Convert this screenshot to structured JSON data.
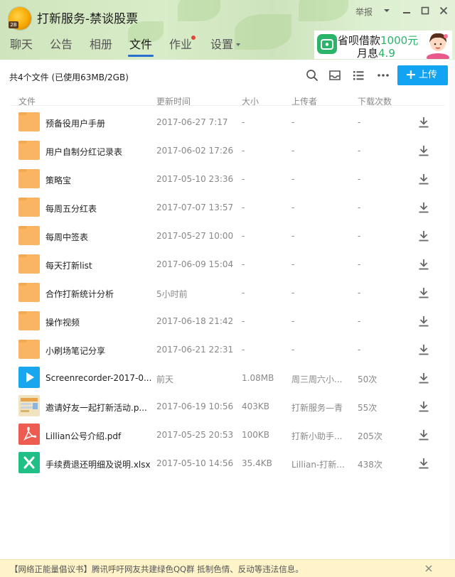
{
  "header": {
    "title": "打新服务-禁谈股票",
    "avatar_badge": "2B",
    "report_label": "举报",
    "tabs": [
      {
        "label": "聊天",
        "active": false
      },
      {
        "label": "公告",
        "active": false
      },
      {
        "label": "相册",
        "active": false
      },
      {
        "label": "文件",
        "active": true
      },
      {
        "label": "作业",
        "active": false,
        "red_dot": true
      },
      {
        "label": "设置",
        "active": false,
        "dropdown": true
      }
    ],
    "ad": {
      "line1_text": "省呗借款",
      "line1_highlight": "1000元",
      "line2_text": "月息",
      "line2_highlight": "4.9"
    }
  },
  "toolbar": {
    "summary": "共4个文件 (已使用63MB/2GB)",
    "upload_label": "上传",
    "accent_color": "#12a3f2"
  },
  "table": {
    "columns": [
      "文件",
      "更新时间",
      "大小",
      "上传者",
      "下载次数"
    ],
    "rows": [
      {
        "name": "预备役用户手册",
        "updated": "2017-06-27 7:17",
        "size": "-",
        "uploader": "-",
        "downloads": "-",
        "type": "folder"
      },
      {
        "name": "用户自制分红记录表",
        "updated": "2017-06-02 17:26",
        "size": "-",
        "uploader": "-",
        "downloads": "-",
        "type": "folder"
      },
      {
        "name": "策略宝",
        "updated": "2017-05-10 23:36",
        "size": "-",
        "uploader": "-",
        "downloads": "-",
        "type": "folder"
      },
      {
        "name": "每周五分红表",
        "updated": "2017-07-07 13:57",
        "size": "-",
        "uploader": "-",
        "downloads": "-",
        "type": "folder"
      },
      {
        "name": "每周中签表",
        "updated": "2017-05-27 10:00",
        "size": "-",
        "uploader": "-",
        "downloads": "-",
        "type": "folder"
      },
      {
        "name": "每天打新list",
        "updated": "2017-06-09 15:04",
        "size": "-",
        "uploader": "-",
        "downloads": "-",
        "type": "folder"
      },
      {
        "name": "合作打新统计分析",
        "updated": "5小时前",
        "size": "-",
        "uploader": "-",
        "downloads": "-",
        "type": "folder"
      },
      {
        "name": "操作视频",
        "updated": "2017-06-18 21:42",
        "size": "-",
        "uploader": "-",
        "downloads": "-",
        "type": "folder"
      },
      {
        "name": "小刷场笔记分享",
        "updated": "2017-06-21 22:31",
        "size": "-",
        "uploader": "-",
        "downloads": "-",
        "type": "folder"
      },
      {
        "name": "Screenrecorder-2017-0...",
        "updated": "前天",
        "size": "1.08MB",
        "uploader": "周三周六小...",
        "downloads": "50次",
        "type": "video"
      },
      {
        "name": "邀请好友一起打新活动.p...",
        "updated": "2017-06-19 10:56",
        "size": "403KB",
        "uploader": "打新服务—青",
        "downloads": "55次",
        "type": "image"
      },
      {
        "name": "Lillian公号介绍.pdf",
        "updated": "2017-05-25 20:53",
        "size": "100KB",
        "uploader": "打新小助手...",
        "downloads": "205次",
        "type": "pdf"
      },
      {
        "name": "手续费退还明细及说明.xlsx",
        "updated": "2017-05-10 14:56",
        "size": "35.4KB",
        "uploader": "Lillian-打新...",
        "downloads": "438次",
        "type": "excel"
      }
    ]
  },
  "notice": {
    "text": "【网络正能量倡议书】腾讯呼吁网友共建绿色QQ群 抵制色情、反动等违法信息。"
  },
  "colors": {
    "folder": "#f9b563",
    "video": "#18a6ee",
    "pdf": "#ee5b50",
    "excel": "#1fbf86",
    "tab_underline": "#2a6fd0"
  }
}
